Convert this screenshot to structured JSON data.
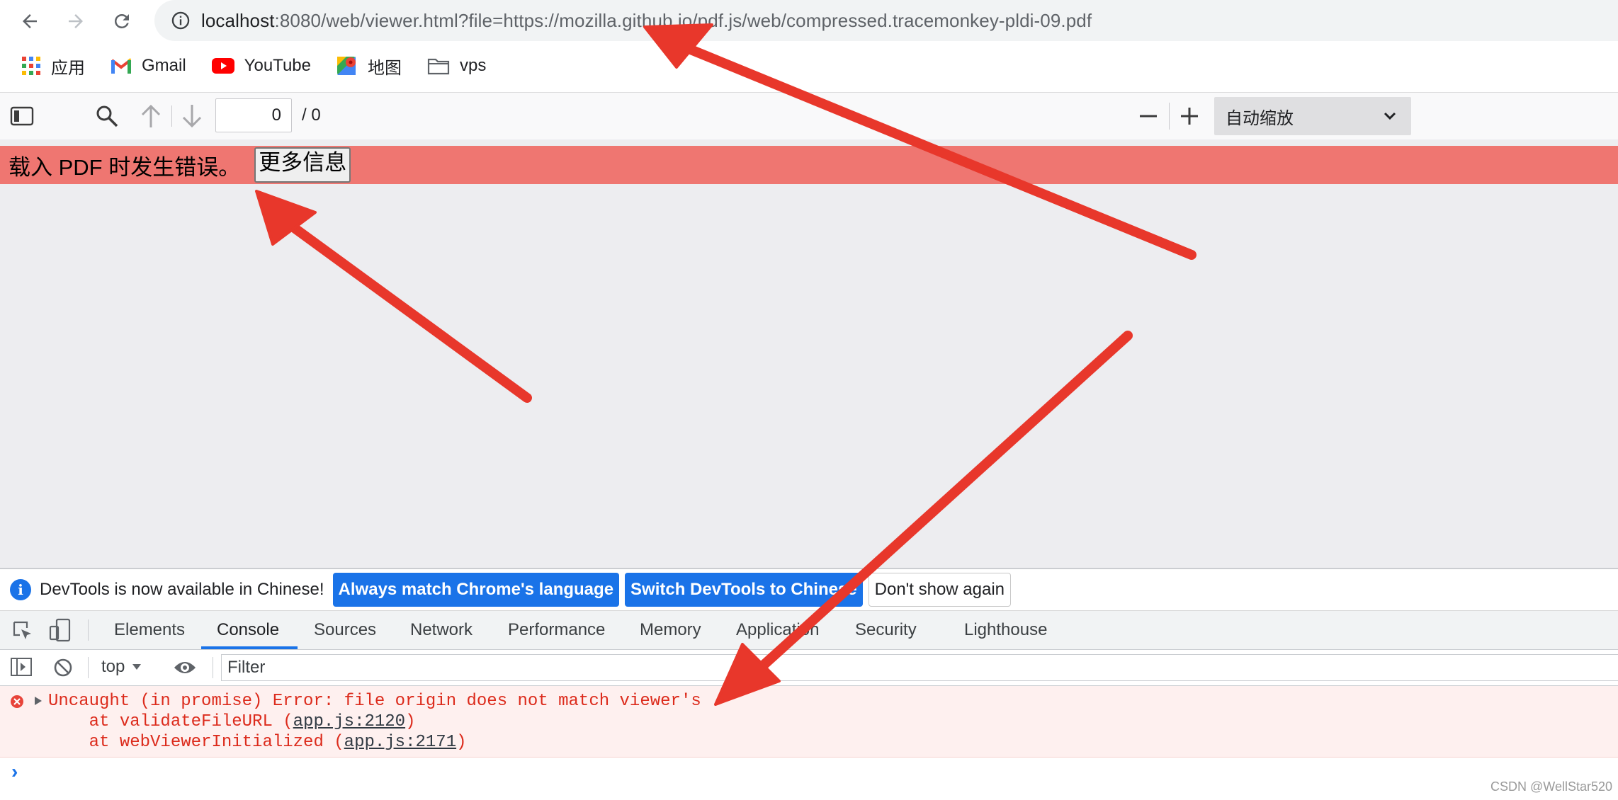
{
  "browser": {
    "url_host": "localhost",
    "url_rest": ":8080/web/viewer.html?file=https://mozilla.github.io/pdf.js/web/compressed.tracemonkey-pldi-09.pdf",
    "icons": [
      "back-arrow-icon",
      "forward-arrow-icon",
      "reload-icon",
      "info-icon"
    ],
    "bookmarks": [
      {
        "label": "应用",
        "icon": "apps-grid-icon"
      },
      {
        "label": "Gmail",
        "icon": "gmail-icon"
      },
      {
        "label": "YouTube",
        "icon": "youtube-icon"
      },
      {
        "label": "地图",
        "icon": "maps-icon"
      },
      {
        "label": "vps",
        "icon": "folder-icon"
      }
    ]
  },
  "pdf_viewer": {
    "page_number": "0",
    "page_total": "/ 0",
    "zoom": "自动缩放",
    "icons": [
      "sidebar-toggle-icon",
      "search-icon",
      "previous-page-icon",
      "next-page-icon",
      "zoom-out-icon",
      "zoom-in-icon",
      "chevron-down-icon"
    ],
    "error_message": "载入 PDF 时发生错误。",
    "more_info_label": "更多信息",
    "colors": {
      "error_bar": "#ef7671",
      "viewer_bg": "#ededf0"
    }
  },
  "devtools": {
    "info_text": "DevTools is now available in Chinese!",
    "btn_match": "Always match Chrome's language",
    "btn_switch": "Switch DevTools to Chinese",
    "btn_dont_show": "Don't show again",
    "tabs": [
      "Elements",
      "Console",
      "Sources",
      "Network",
      "Performance",
      "Memory",
      "Application",
      "Security",
      "Lighthouse"
    ],
    "active_tab": "Console",
    "context": "top",
    "filter_placeholder": "Filter",
    "error_line1": "Uncaught (in promise) Error: file origin does not match viewer's",
    "error_line2_prefix": "    at validateFileURL (",
    "error_line2_link": "app.js:2120",
    "error_line3_prefix": "    at webViewerInitialized (",
    "error_line3_link": "app.js:2171",
    "prompt": "›",
    "colors": {
      "accent": "#1a73e8",
      "error_text": "#dc2b1c",
      "error_bg": "#fef0ef"
    }
  },
  "watermark": "CSDN @WellStar520",
  "annotation_color": "#e8372b"
}
